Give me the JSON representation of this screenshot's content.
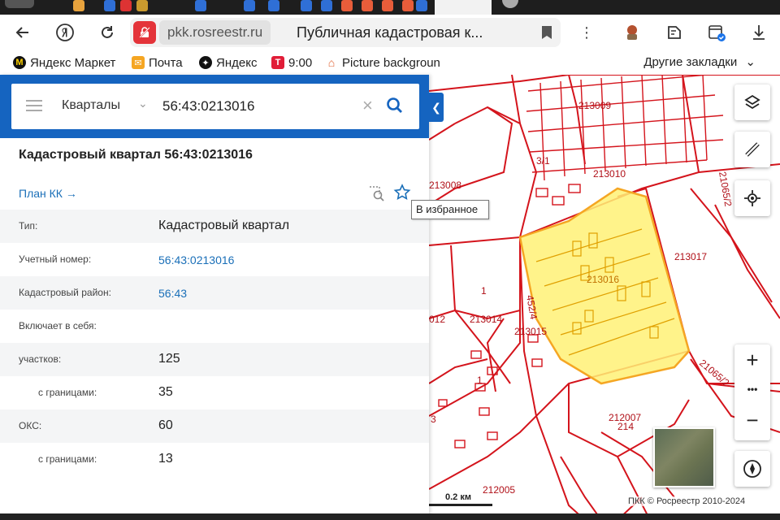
{
  "browser": {
    "domain": "pkk.rosreestr.ru",
    "page_title": "Публичная кадастровая к...",
    "back_icon": "arrow-left-icon",
    "yandex_icon": "yandex-ya-icon",
    "reload_icon": "reload-icon"
  },
  "bookmarks": [
    {
      "label": "Яндекс Маркет",
      "icon": "market-icon",
      "color": "#1a1a1a"
    },
    {
      "label": "Почта",
      "icon": "mail-icon",
      "color": "#f5a623"
    },
    {
      "label": "Яндекс",
      "icon": "yandex-icon",
      "color": "#111111"
    },
    {
      "label": "9:00",
      "icon": "t-icon",
      "color": "#e11d38"
    },
    {
      "label": "Picture backgroun",
      "icon": "home-icon",
      "color": "#e06030"
    }
  ],
  "bookmarks_other": "Другие закладки",
  "search": {
    "category": "Кварталы",
    "query": "56:43:0213016"
  },
  "card": {
    "title": "Кадастровый квартал 56:43:0213016",
    "plan_link": "План КК →",
    "tooltip": "В избранное",
    "rows": [
      {
        "key": "Тип:",
        "value": "Кадастровый квартал",
        "link": false,
        "sub": false
      },
      {
        "key": "Учетный номер:",
        "value": "56:43:0213016",
        "link": true,
        "sub": false
      },
      {
        "key": "Кадастровый район:",
        "value": "56:43",
        "link": true,
        "sub": false
      },
      {
        "key": "Включает в себя:",
        "value": "",
        "link": false,
        "sub": false
      },
      {
        "key": "участков:",
        "value": "125",
        "link": false,
        "sub": false
      },
      {
        "key": "с границами:",
        "value": "35",
        "link": false,
        "sub": true
      },
      {
        "key": "ОКС:",
        "value": "60",
        "link": false,
        "sub": false
      },
      {
        "key": "с границами:",
        "value": "13",
        "link": false,
        "sub": true
      }
    ]
  },
  "map": {
    "labels": [
      "213009",
      "213010",
      "213008",
      "21065/2",
      "213017",
      "213016",
      "213014",
      "213015",
      "452/4",
      "1",
      "1",
      "3/1",
      "012",
      "21065/2",
      "212007",
      "214",
      "3",
      "212005"
    ],
    "scale": "0.2 км",
    "copyright": "ПКК © Росреестр 2010-2024",
    "zoom_in": "+",
    "zoom_more": "•••",
    "zoom_out": "−",
    "highlight_color": "#fff176",
    "boundary_color": "#d4141c"
  }
}
